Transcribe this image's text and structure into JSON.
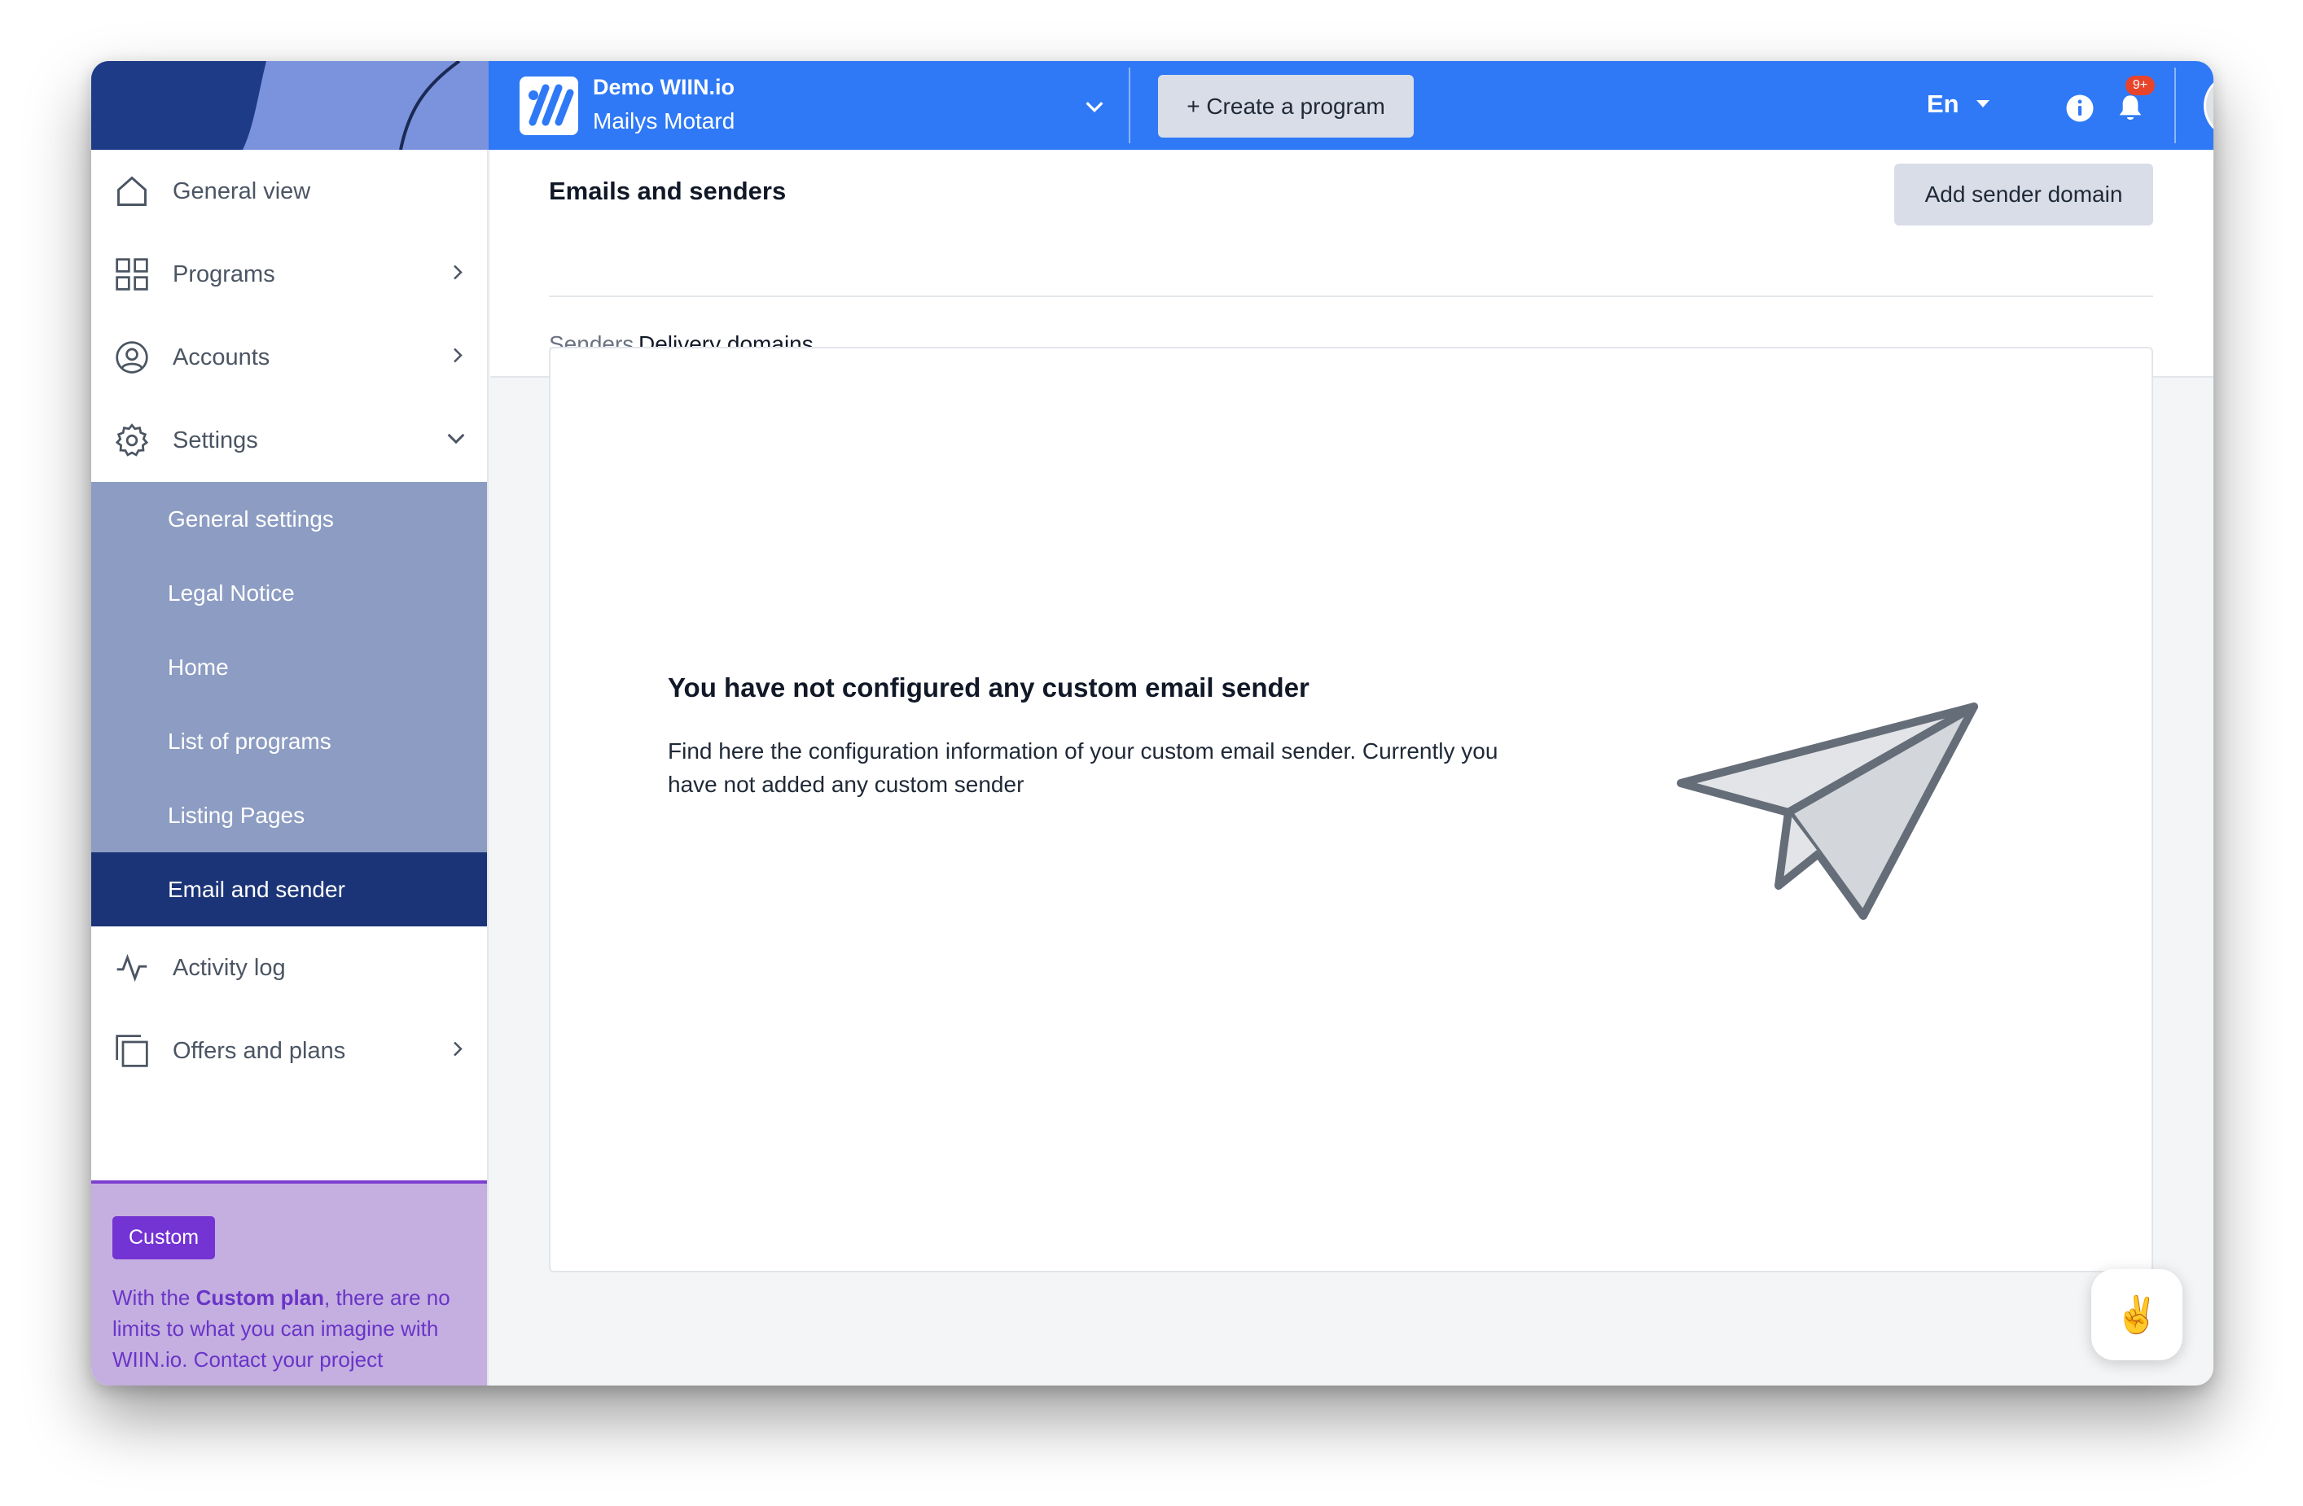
{
  "topbar": {
    "org_name": "Demo WIIN.io",
    "user_name": "Mailys Motard",
    "create_program_label": "+ Create a program",
    "language": "En",
    "notification_count": "9+"
  },
  "sidebar": {
    "items": [
      {
        "label": "General view",
        "icon": "home-icon"
      },
      {
        "label": "Programs",
        "icon": "grid-icon"
      },
      {
        "label": "Accounts",
        "icon": "user-circle-icon"
      },
      {
        "label": "Settings",
        "icon": "gear-icon"
      }
    ],
    "settings_sub": [
      {
        "label": "General settings"
      },
      {
        "label": "Legal Notice"
      },
      {
        "label": "Home"
      },
      {
        "label": "List of programs"
      },
      {
        "label": "Listing Pages"
      },
      {
        "label": "Email and sender",
        "active": true
      }
    ],
    "bottom_items": [
      {
        "label": "Activity log",
        "icon": "activity-icon"
      },
      {
        "label": "Offers and plans",
        "icon": "copy-icon"
      }
    ],
    "promo": {
      "badge": "Custom",
      "text_before": "With the ",
      "text_bold": "Custom plan",
      "text_after": ", there are no limits to what you can imagine with WIIN.io. Contact your project"
    }
  },
  "main": {
    "title": "Emails and senders",
    "add_button": "Add sender domain",
    "tabs": [
      {
        "label": "Senders",
        "active": false
      },
      {
        "label": "Delivery domains",
        "active": true
      }
    ],
    "empty_state": {
      "title": "You have not configured any custom email sender",
      "text": "Find here the configuration information of your custom email sender. Currently you have not added any custom sender",
      "illustration": "paper-plane-icon"
    }
  },
  "help_button": "✌️",
  "colors": {
    "topbar": "#2f79f6",
    "sidebar_sub": "#8c9cc2",
    "sidebar_active": "#1b3478",
    "promo_bg": "#c4afe0",
    "promo_accent": "#7433d3"
  }
}
